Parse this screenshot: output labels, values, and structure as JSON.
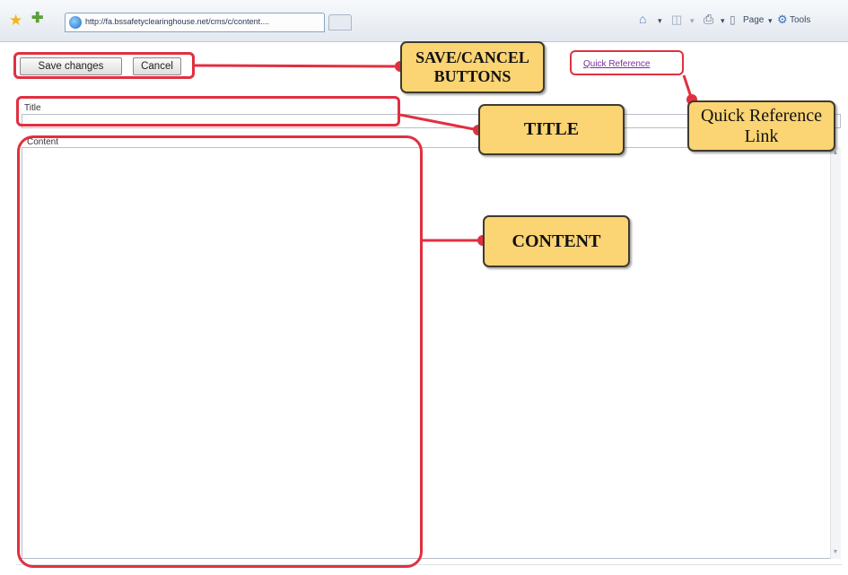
{
  "browser": {
    "tab_url": "http://fa.bssafetyclearinghouse.net/cms/c/content....",
    "commands": {
      "page_label": "Page",
      "tools_label": "Tools"
    }
  },
  "form": {
    "save_label": "Save changes",
    "cancel_label": "Cancel",
    "quick_reference_link": "Quick Reference",
    "title_label": "Title",
    "title_value": "",
    "content_label": "Content",
    "content_value": ""
  },
  "annotations": {
    "save_cancel": "SAVE/CANCEL BUTTONS",
    "title": "TITLE",
    "quick_reference": "Quick Reference Link",
    "content": "CONTENT"
  },
  "colors": {
    "highlight": "#e03040",
    "callout_fill": "#fbd473",
    "link": "#7a2f9e"
  }
}
